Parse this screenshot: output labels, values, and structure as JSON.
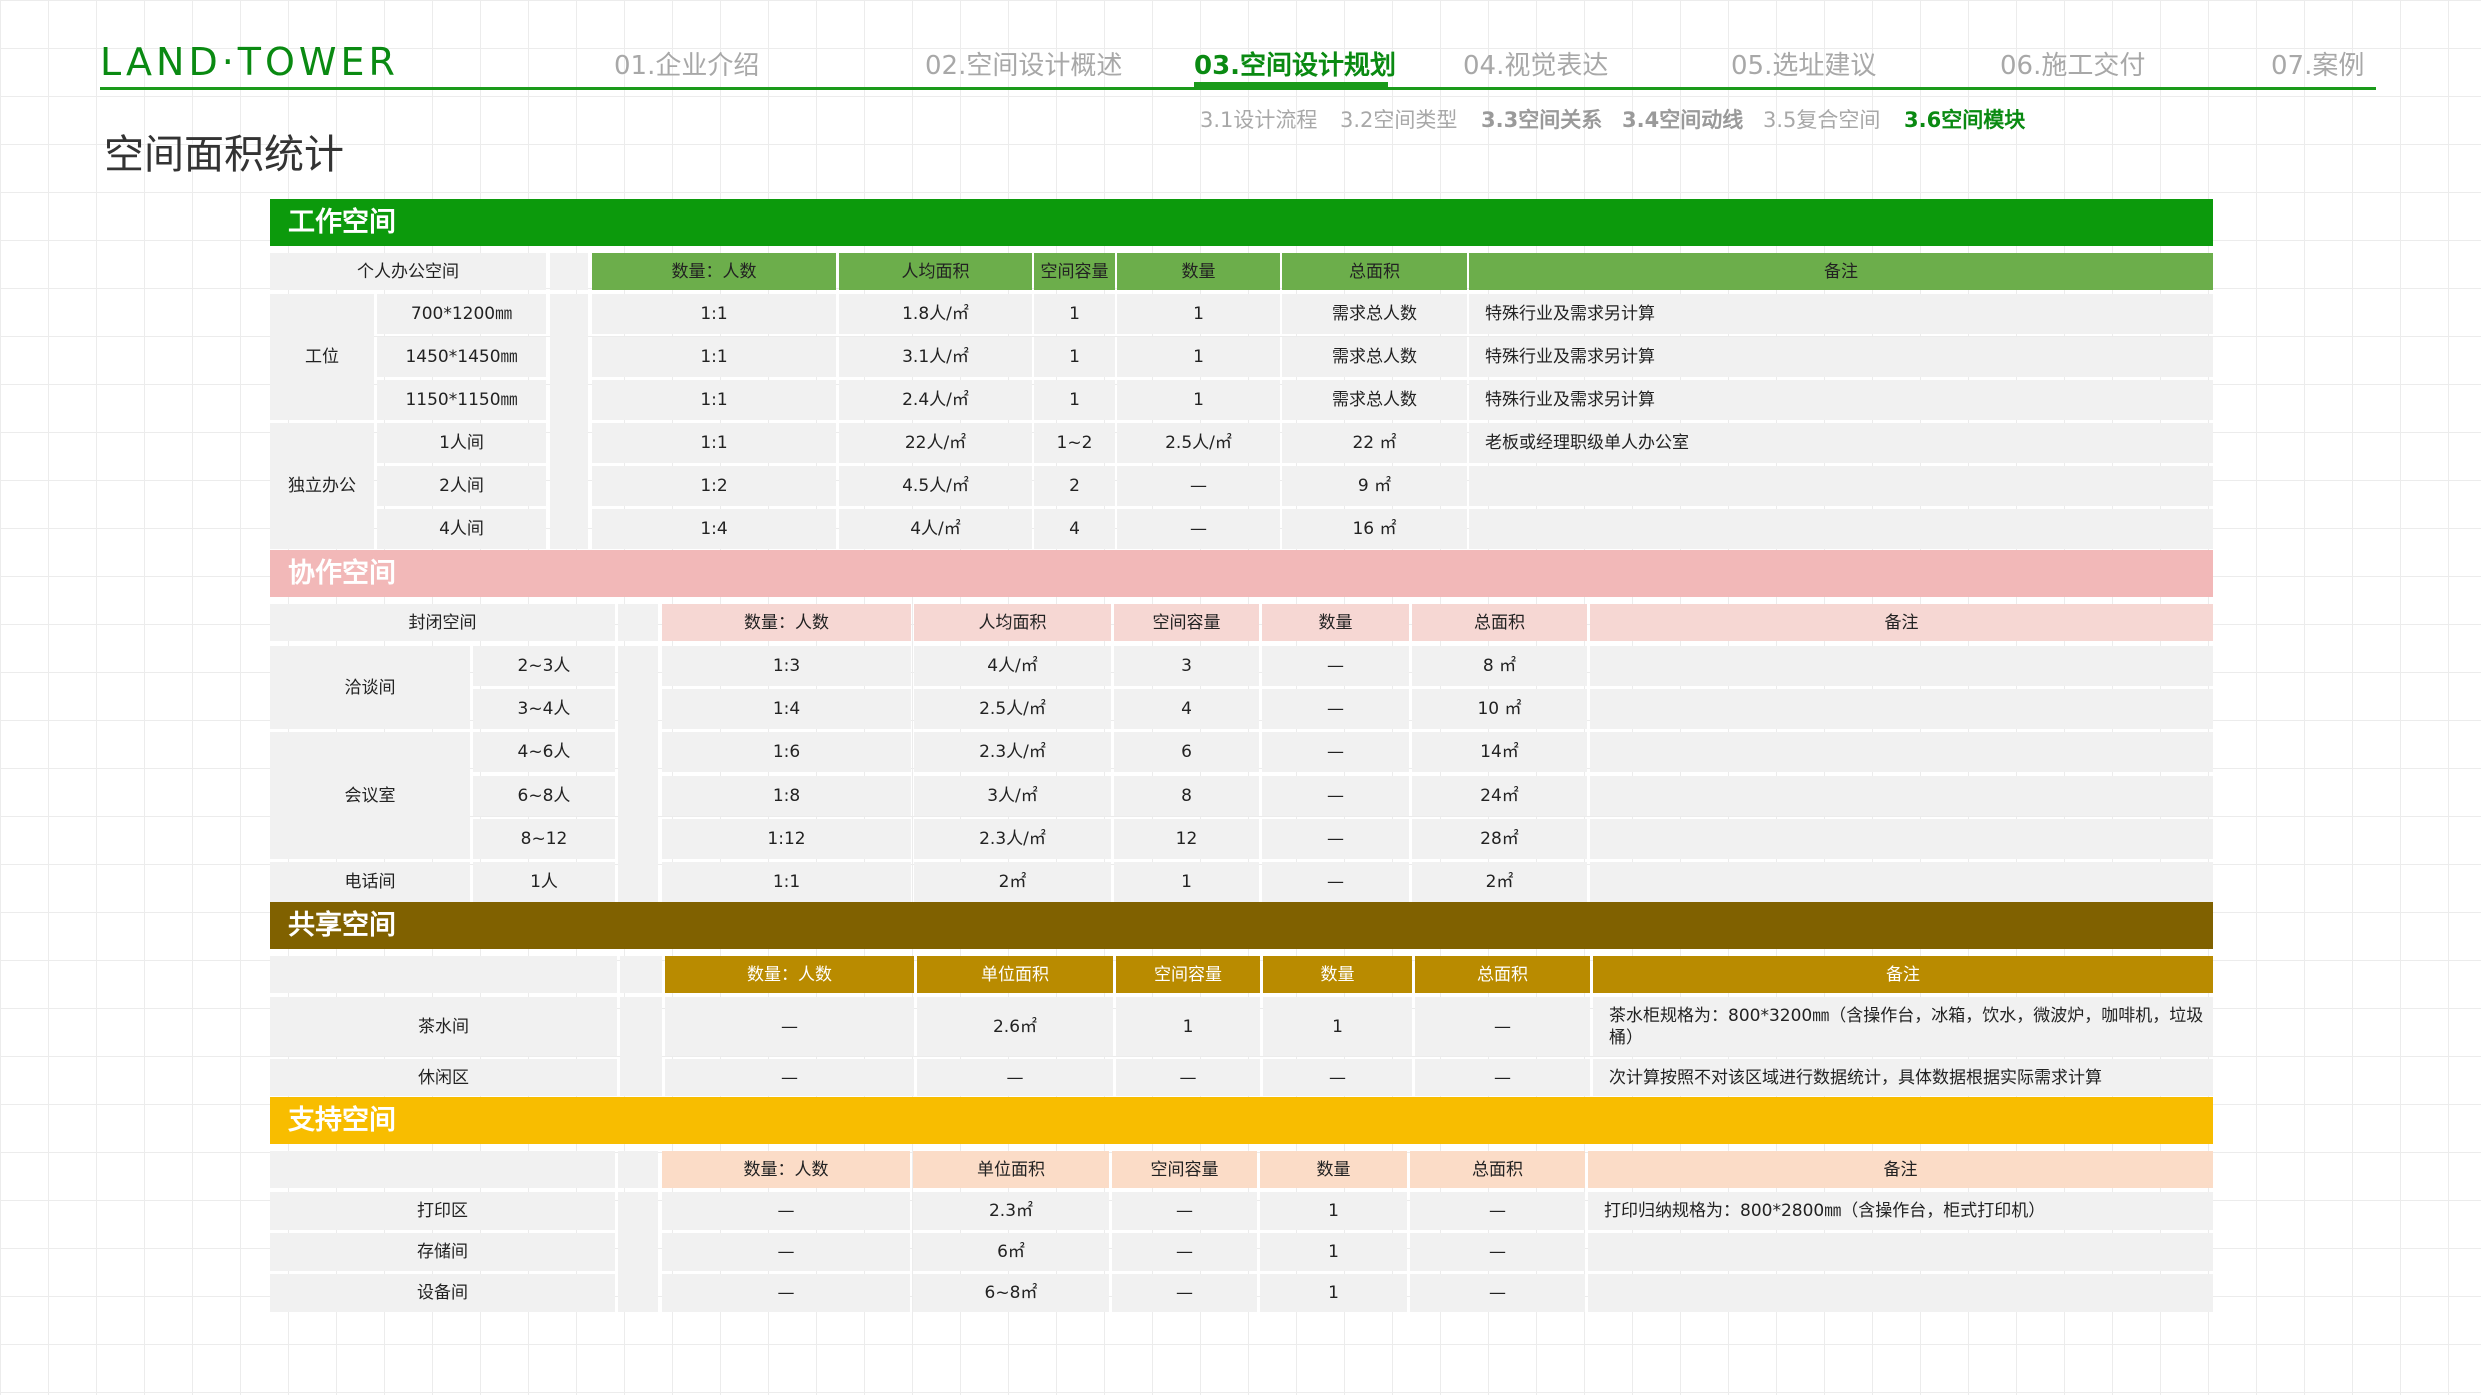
{
  "header": {
    "logo": "LAND·TOWER",
    "nav": [
      "01.企业介绍",
      "02.空间设计概述",
      "03.空间设计规划",
      "04.视觉表达",
      "05.选址建议",
      "06.施工交付",
      "07.案例"
    ],
    "subnav": [
      "3.1设计流程",
      "3.2空间类型",
      "3.3空间关系",
      "3.4空间动线",
      "3.5复合空间",
      "3.6空间模块"
    ]
  },
  "page_title": "空间面积统计",
  "colors": {
    "brand": "#0a8a12",
    "work_band": "#0c9a0c",
    "work_header": "#6cae4b",
    "collab_band": "#f2b8b8",
    "collab_header": "#f6d7d3",
    "shared_band": "#806100",
    "shared_header": "#b98b00",
    "support_band": "#f8bd00",
    "support_header": "#fbdcc7",
    "cell_bg": "#f1f1f1"
  },
  "work": {
    "title": "工作空间",
    "label": "个人办公空间",
    "headers": [
      "数量：人数",
      "人均面积",
      "空间容量",
      "数量",
      "总面积",
      "备注"
    ],
    "groups": [
      "工位",
      "独立办公"
    ],
    "rows": [
      {
        "sub": "700*1200㎜",
        "vals": [
          "1:1",
          "1.8人/㎡",
          "1",
          "1",
          "需求总人数",
          "特殊行业及需求另计算"
        ]
      },
      {
        "sub": "1450*1450㎜",
        "vals": [
          "1:1",
          "3.1人/㎡",
          "1",
          "1",
          "需求总人数",
          "特殊行业及需求另计算"
        ]
      },
      {
        "sub": "1150*1150㎜",
        "vals": [
          "1:1",
          "2.4人/㎡",
          "1",
          "1",
          "需求总人数",
          "特殊行业及需求另计算"
        ]
      },
      {
        "sub": "1人间",
        "vals": [
          "1:1",
          "22人/㎡",
          "1~2",
          "2.5人/㎡",
          "22 ㎡",
          "老板或经理职级单人办公室"
        ]
      },
      {
        "sub": "2人间",
        "vals": [
          "1:2",
          "4.5人/㎡",
          "2",
          "—",
          "9 ㎡",
          ""
        ]
      },
      {
        "sub": "4人间",
        "vals": [
          "1:4",
          "4人/㎡",
          "4",
          "—",
          "16 ㎡",
          ""
        ]
      }
    ]
  },
  "collab": {
    "title": "协作空间",
    "label": "封闭空间",
    "headers": [
      "数量：人数",
      "人均面积",
      "空间容量",
      "数量",
      "总面积",
      "备注"
    ],
    "groups": [
      "洽谈间",
      "会议室",
      "电话间"
    ],
    "rows": [
      {
        "sub": "2~3人",
        "vals": [
          "1:3",
          "4人/㎡",
          "3",
          "—",
          "8 ㎡",
          ""
        ]
      },
      {
        "sub": "3~4人",
        "vals": [
          "1:4",
          "2.5人/㎡",
          "4",
          "—",
          "10 ㎡",
          ""
        ]
      },
      {
        "sub": "4~6人",
        "vals": [
          "1:6",
          "2.3人/㎡",
          "6",
          "—",
          "14㎡",
          ""
        ]
      },
      {
        "sub": "6~8人",
        "vals": [
          "1:8",
          "3人/㎡",
          "8",
          "—",
          "24㎡",
          ""
        ]
      },
      {
        "sub": "8~12",
        "vals": [
          "1:12",
          "2.3人/㎡",
          "12",
          "—",
          "28㎡",
          ""
        ]
      },
      {
        "sub": "1人",
        "vals": [
          "1:1",
          "2㎡",
          "1",
          "—",
          "2㎡",
          ""
        ]
      }
    ]
  },
  "shared": {
    "title": "共享空间",
    "headers": [
      "数量：人数",
      "单位面积",
      "空间容量",
      "数量",
      "总面积",
      "备注"
    ],
    "rows": [
      {
        "name": "茶水间",
        "vals": [
          "—",
          "2.6㎡",
          "1",
          "1",
          "—",
          "茶水柜规格为：800*3200㎜（含操作台，冰箱，饮水，微波炉，咖啡机，垃圾桶）"
        ]
      },
      {
        "name": "休闲区",
        "vals": [
          "—",
          "—",
          "—",
          "—",
          "—",
          "次计算按照不对该区域进行数据统计，具体数据根据实际需求计算"
        ]
      }
    ]
  },
  "support": {
    "title": "支持空间",
    "headers": [
      "数量：人数",
      "单位面积",
      "空间容量",
      "数量",
      "总面积",
      "备注"
    ],
    "rows": [
      {
        "name": "打印区",
        "vals": [
          "—",
          "2.3㎡",
          "—",
          "1",
          "—",
          "打印归纳规格为：800*2800㎜（含操作台，柜式打印机）"
        ]
      },
      {
        "name": "存储间",
        "vals": [
          "—",
          "6㎡",
          "—",
          "1",
          "—",
          ""
        ]
      },
      {
        "name": "设备间",
        "vals": [
          "—",
          "6~8㎡",
          "—",
          "1",
          "—",
          ""
        ]
      }
    ]
  }
}
